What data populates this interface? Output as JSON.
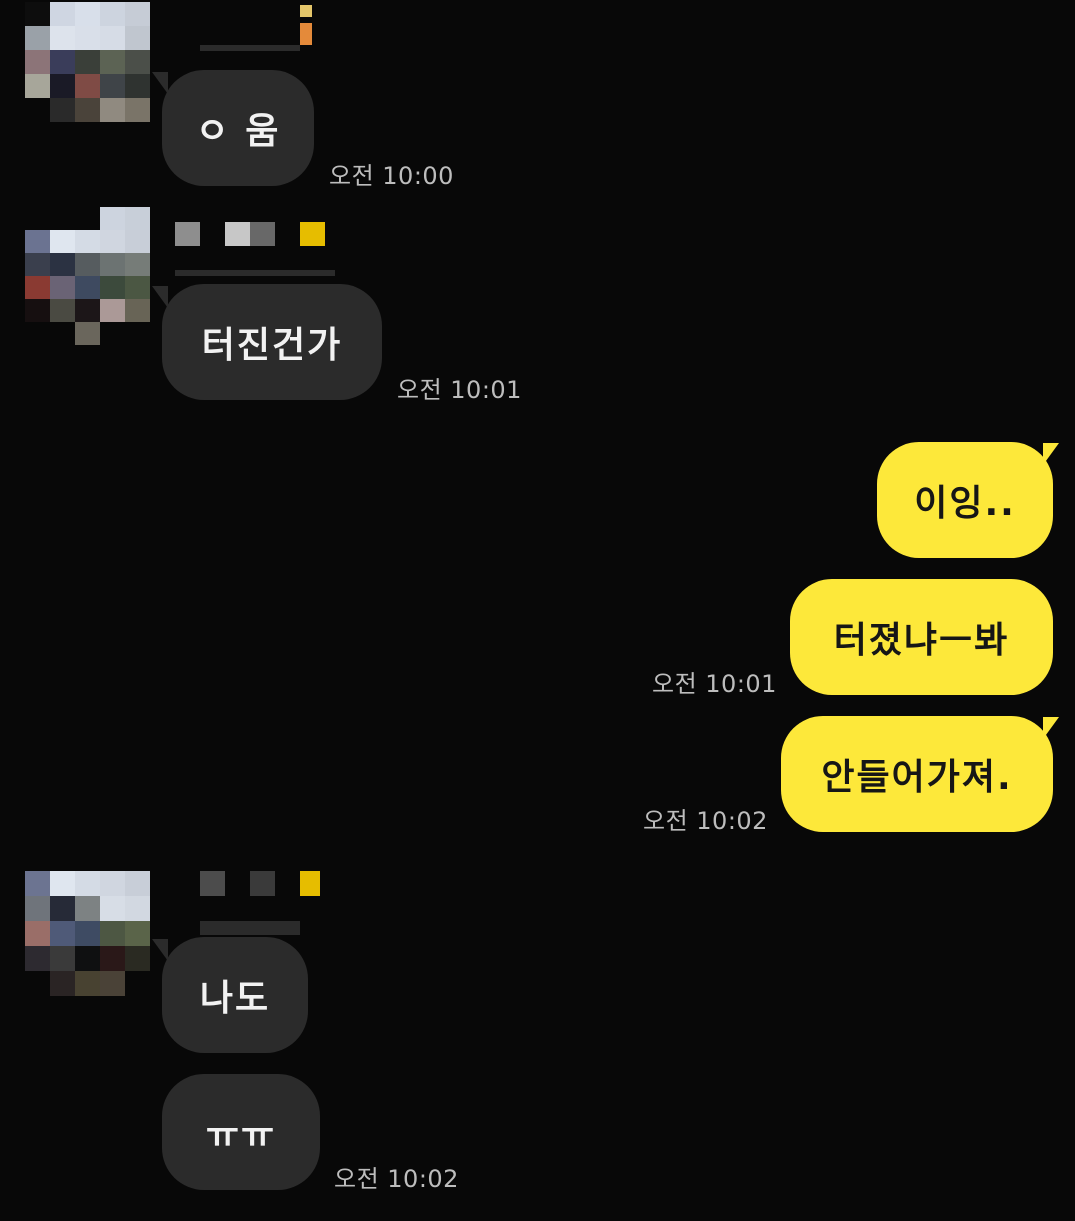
{
  "messages": {
    "m1": {
      "text": "ㅇ 움",
      "time": "오전 10:00"
    },
    "m2": {
      "text": "터진건가",
      "time": "오전 10:01"
    },
    "m3": {
      "text": "이잉..",
      "time": ""
    },
    "m4": {
      "text": "터졌냐ㅡ봐",
      "time": "오전 10:01"
    },
    "m5": {
      "text": "안들어가져.",
      "time": "오전 10:02"
    },
    "m6": {
      "text": "나도",
      "time": ""
    },
    "m7": {
      "text": "ㅠㅠ",
      "time": "오전 10:02"
    }
  },
  "colors": {
    "background": "#080808",
    "incoming_bubble": "#2b2b2b",
    "outgoing_bubble": "#fde83a",
    "timestamp": "#bdbdbd"
  },
  "icons": {
    "avatar": "profile-avatar-pixelated"
  }
}
